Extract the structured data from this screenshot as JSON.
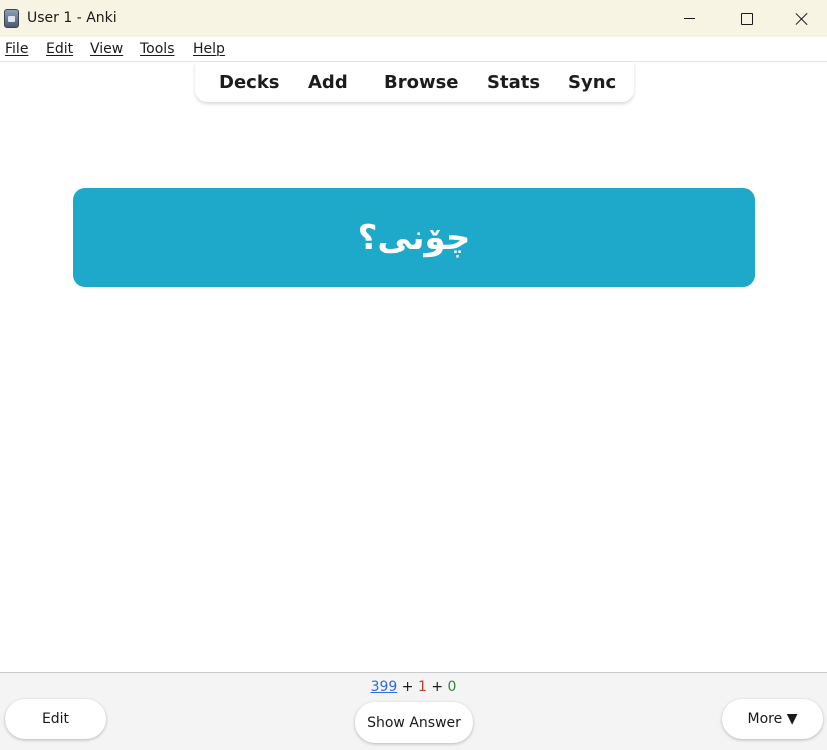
{
  "window": {
    "title": "User 1 - Anki",
    "app_icon": "anki-icon"
  },
  "menubar": {
    "items": [
      {
        "label": "File"
      },
      {
        "label": "Edit"
      },
      {
        "label": "View"
      },
      {
        "label": "Tools"
      },
      {
        "label": "Help"
      }
    ]
  },
  "toolbar": {
    "decks": "Decks",
    "add": "Add",
    "browse": "Browse",
    "stats": "Stats",
    "sync": "Sync"
  },
  "card": {
    "question": "چۆنی؟",
    "color": "#1ea8c9"
  },
  "bottom": {
    "counts": {
      "new": "399",
      "plus1": "+",
      "learn": "1",
      "plus2": "+",
      "review": "0"
    },
    "edit_label": "Edit",
    "show_answer_label": "Show Answer",
    "more_label": "More ▼"
  },
  "colors": {
    "new_count": "#2a6ed8",
    "learn_count": "#c0392b",
    "review_count": "#2a8a36",
    "titlebar": "#f8f4e4"
  }
}
